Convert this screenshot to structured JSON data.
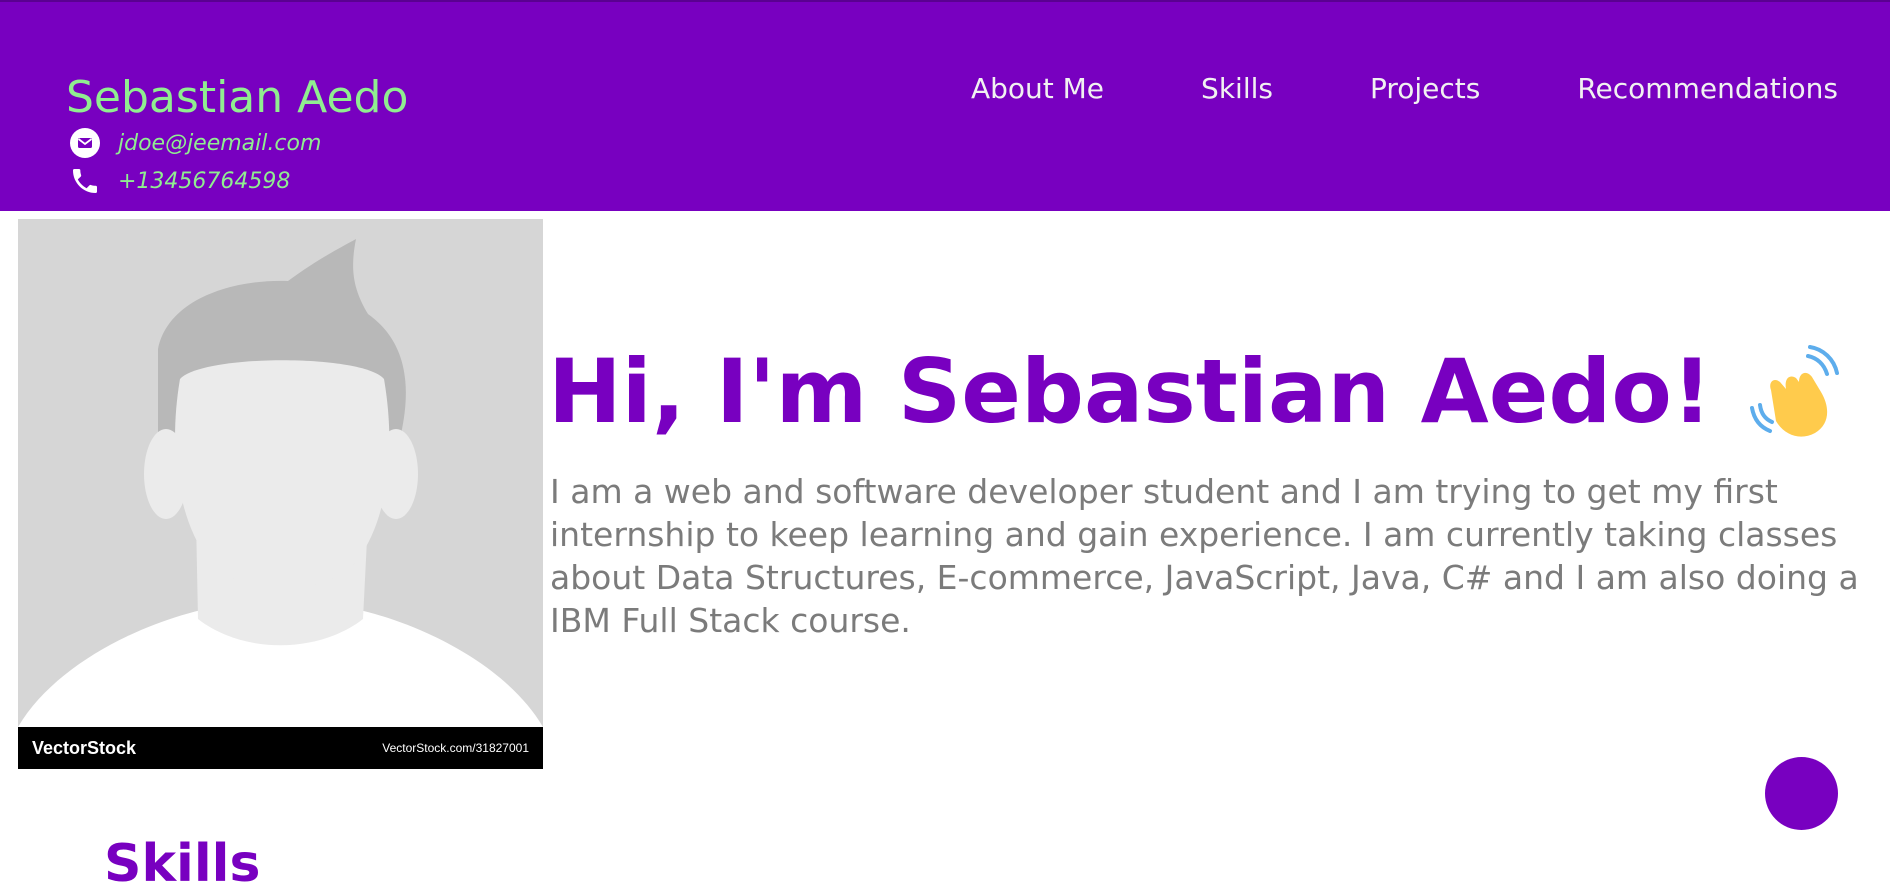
{
  "header": {
    "name": "Sebastian Aedo",
    "email": "jdoe@jeemail.com",
    "phone": "+13456764598",
    "nav": [
      "About Me",
      "Skills",
      "Projects",
      "Recommendations"
    ]
  },
  "profile": {
    "watermark_brand": "VectorStock",
    "watermark_url": "VectorStock.com/31827001"
  },
  "hero": {
    "title": "Hi, I'm Sebastian Aedo!",
    "intro": "I am a web and software developer student and I am trying to get my first internship to keep learning and gain experience. I am currently taking classes about Data Structures, E-commerce, JavaScript, Java, C# and I am also doing a IBM Full Stack course."
  },
  "sections": {
    "skills_title": "Skills"
  },
  "icons": {
    "email": "envelope-icon",
    "phone": "phone-icon",
    "wave": "waving-hand-icon"
  },
  "colors": {
    "brand_purple": "#7800c0",
    "name_green": "#90ee90",
    "body_text": "#7b7b7b"
  }
}
